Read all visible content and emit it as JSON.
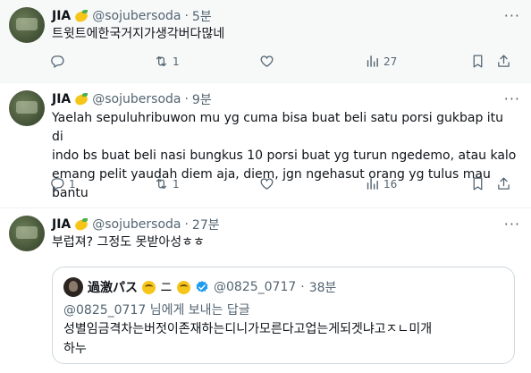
{
  "tweets": [
    {
      "name": "JIA",
      "handle": "@sojubersoda",
      "dot": "·",
      "time": "5분",
      "text": "트윗트에한국거지가생각버다많네",
      "stats": {
        "replies": "",
        "retweets": "1",
        "likes": "",
        "views": "27"
      }
    },
    {
      "name": "JIA",
      "handle": "@sojubersoda",
      "dot": "·",
      "time": "9분",
      "text_lines": [
        "Yaelah sepuluhribuwon mu yg cuma bisa buat beli satu porsi gukbap itu di",
        "indo bs buat beli nasi bungkus 10 porsi buat yg turun ngedemo, atau kalo",
        "emang pelit yaudah diem aja, diem, jgn ngehasut orang yg tulus mau bantu"
      ],
      "stats": {
        "replies": "1",
        "retweets": "1",
        "likes": "",
        "views": "16"
      }
    },
    {
      "name": "JIA",
      "handle": "@sojubersoda",
      "dot": "·",
      "time": "27분",
      "text": "부럽져? 그정도 못받아성ㅎㅎ",
      "quote": {
        "name": "過激パス",
        "separator": "ニ",
        "handle": "@0825_0717",
        "dot": "·",
        "time": "38분",
        "reply_to": "@0825_0717 님에게 보내는 답글",
        "text_lines": [
          "성별임금격차는버젓이존재하는디니가모른다고업는게되겟냐고ㅈㄴ미개",
          "하누"
        ]
      }
    }
  ],
  "icons": [
    "more-icon",
    "reply-icon",
    "retweet-icon",
    "like-icon",
    "views-icon",
    "bookmark-icon",
    "share-icon",
    "verified-icon"
  ],
  "colors": {
    "text": "#0f1419",
    "secondary": "#536471",
    "border": "#cfd9de",
    "verified": "#1d9bf0",
    "highlight_bg": "#f7f9f9"
  }
}
